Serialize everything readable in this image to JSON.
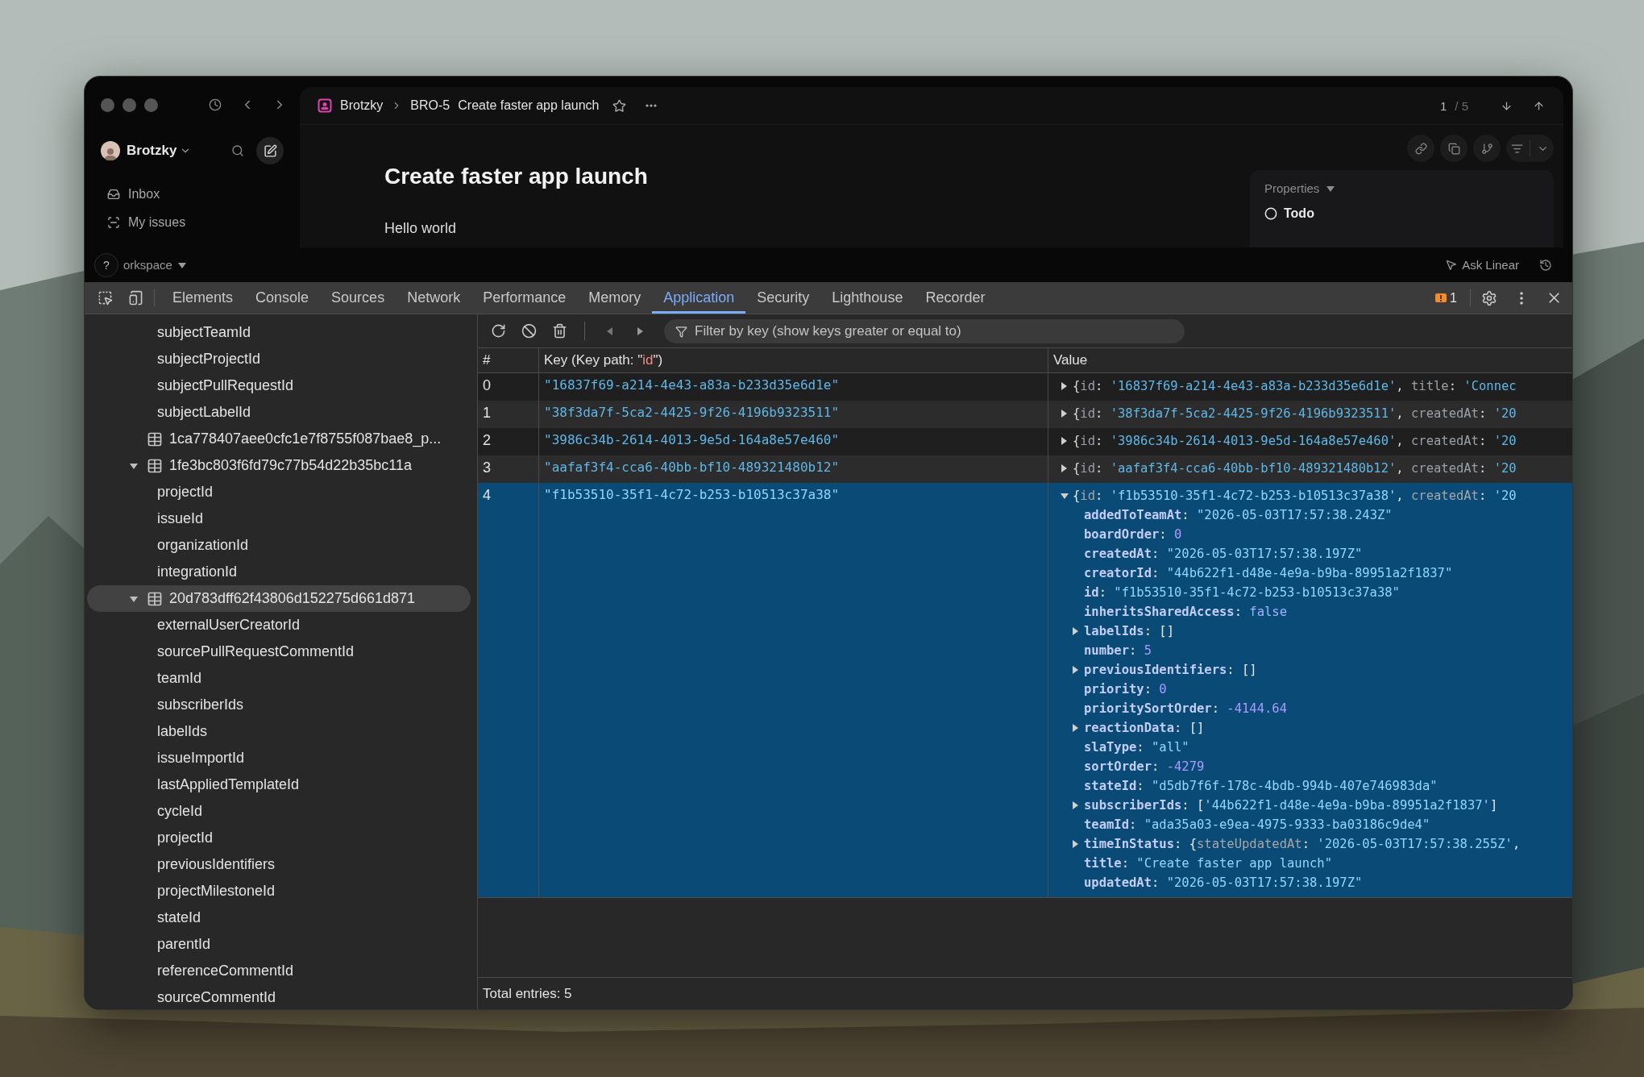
{
  "topbar": {
    "team": "Brotzky",
    "issue_id": "BRO-5",
    "issue_title": "Create faster app launch",
    "pager_current": "1",
    "pager_total": "/ 5"
  },
  "sidebar": {
    "workspace": "Brotzky",
    "items": [
      {
        "label": "Inbox",
        "kind": "inbox"
      },
      {
        "label": "My issues",
        "kind": "issues"
      }
    ],
    "help": "?",
    "workspace_menu": "orkspace"
  },
  "issue": {
    "title": "Create faster app launch",
    "body": "Hello world"
  },
  "properties": {
    "heading": "Properties",
    "status": "Todo"
  },
  "ask": "Ask Linear",
  "devtools": {
    "tabs": [
      {
        "label": "Elements",
        "selected": false
      },
      {
        "label": "Console",
        "selected": false
      },
      {
        "label": "Sources",
        "selected": false
      },
      {
        "label": "Network",
        "selected": false
      },
      {
        "label": "Performance",
        "selected": false
      },
      {
        "label": "Memory",
        "selected": false
      },
      {
        "label": "Application",
        "selected": true
      },
      {
        "label": "Security",
        "selected": false
      },
      {
        "label": "Lighthouse",
        "selected": false
      },
      {
        "label": "Recorder",
        "selected": false
      }
    ],
    "issues_count": "1",
    "tree": [
      {
        "kind": "index",
        "label": "subjectTeamId"
      },
      {
        "kind": "index",
        "label": "subjectProjectId"
      },
      {
        "kind": "index",
        "label": "subjectPullRequestId"
      },
      {
        "kind": "index",
        "label": "subjectLabelId"
      },
      {
        "kind": "store",
        "label": "1ca778407aee0cfc1e7f8755f087bae8_p...",
        "selected": false
      },
      {
        "kind": "store",
        "label": "1fe3bc803f6fd79c77b54d22b35bc11a",
        "selected": false,
        "expanded": true,
        "children": [
          "projectId",
          "issueId",
          "organizationId",
          "integrationId"
        ]
      },
      {
        "kind": "store",
        "label": "20d783dff62f43806d152275d661d871",
        "selected": true,
        "expanded": true,
        "children": [
          "externalUserCreatorId",
          "sourcePullRequestCommentId",
          "teamId",
          "subscriberIds",
          "labelIds",
          "issueImportId",
          "lastAppliedTemplateId",
          "cycleId",
          "projectId",
          "previousIdentifiers",
          "projectMilestoneId",
          "stateId",
          "parentId",
          "referenceCommentId",
          "sourceCommentId"
        ]
      }
    ],
    "filter": {
      "placeholder": "Filter by key (show keys greater or equal to)"
    },
    "columns": {
      "index": "#",
      "key_prefix": "Key (Key path: \"",
      "key_path": "id",
      "key_suffix": "\")",
      "value": "Value"
    },
    "rows": [
      {
        "index": "0",
        "key": "\"16837f69-a214-4e43-a83a-b233d35e6d1e\"",
        "selected": false,
        "expanded": false,
        "summary": [
          {
            "text": "{",
            "kind": "punct"
          },
          {
            "text": "id",
            "kind": "key"
          },
          {
            "text": ": ",
            "kind": "punct"
          },
          {
            "text": "'16837f69-a214-4e43-a83a-b233d35e6d1e'",
            "kind": "string"
          },
          {
            "text": ", ",
            "kind": "punct"
          },
          {
            "text": "title",
            "kind": "key"
          },
          {
            "text": ": ",
            "kind": "punct"
          },
          {
            "text": "'Connec",
            "kind": "string"
          }
        ]
      },
      {
        "index": "1",
        "key": "\"38f3da7f-5ca2-4425-9f26-4196b9323511\"",
        "selected": false,
        "expanded": false,
        "summary": [
          {
            "text": "{",
            "kind": "punct"
          },
          {
            "text": "id",
            "kind": "key"
          },
          {
            "text": ": ",
            "kind": "punct"
          },
          {
            "text": "'38f3da7f-5ca2-4425-9f26-4196b9323511'",
            "kind": "string"
          },
          {
            "text": ", ",
            "kind": "punct"
          },
          {
            "text": "createdAt",
            "kind": "key"
          },
          {
            "text": ": ",
            "kind": "punct"
          },
          {
            "text": "'20",
            "kind": "string"
          }
        ]
      },
      {
        "index": "2",
        "key": "\"3986c34b-2614-4013-9e5d-164a8e57e460\"",
        "selected": false,
        "expanded": false,
        "summary": [
          {
            "text": "{",
            "kind": "punct"
          },
          {
            "text": "id",
            "kind": "key"
          },
          {
            "text": ": ",
            "kind": "punct"
          },
          {
            "text": "'3986c34b-2614-4013-9e5d-164a8e57e460'",
            "kind": "string"
          },
          {
            "text": ", ",
            "kind": "punct"
          },
          {
            "text": "createdAt",
            "kind": "key"
          },
          {
            "text": ": ",
            "kind": "punct"
          },
          {
            "text": "'20",
            "kind": "string"
          }
        ]
      },
      {
        "index": "3",
        "key": "\"aafaf3f4-cca6-40bb-bf10-489321480b12\"",
        "selected": false,
        "expanded": false,
        "summary": [
          {
            "text": "{",
            "kind": "punct"
          },
          {
            "text": "id",
            "kind": "key"
          },
          {
            "text": ": ",
            "kind": "punct"
          },
          {
            "text": "'aafaf3f4-cca6-40bb-bf10-489321480b12'",
            "kind": "string"
          },
          {
            "text": ", ",
            "kind": "punct"
          },
          {
            "text": "createdAt",
            "kind": "key"
          },
          {
            "text": ": ",
            "kind": "punct"
          },
          {
            "text": "'20",
            "kind": "string"
          }
        ]
      },
      {
        "index": "4",
        "key": "\"f1b53510-35f1-4c72-b253-b10513c37a38\"",
        "selected": true,
        "expanded": true,
        "summary": [
          {
            "text": "{",
            "kind": "punct"
          },
          {
            "text": "id",
            "kind": "key"
          },
          {
            "text": ": ",
            "kind": "punct"
          },
          {
            "text": "'f1b53510-35f1-4c72-b253-b10513c37a38'",
            "kind": "string"
          },
          {
            "text": ", ",
            "kind": "punct"
          },
          {
            "text": "createdAt",
            "kind": "key"
          },
          {
            "text": ": ",
            "kind": "punct"
          },
          {
            "text": "'20",
            "kind": "string"
          }
        ],
        "props": [
          {
            "name": "addedToTeamAt",
            "expandable": false,
            "value": [
              {
                "text": ": ",
                "kind": "punct"
              },
              {
                "text": "\"2026-05-03T17:57:38.243Z\"",
                "kind": "string"
              }
            ]
          },
          {
            "name": "boardOrder",
            "expandable": false,
            "value": [
              {
                "text": ": ",
                "kind": "punct"
              },
              {
                "text": "0",
                "kind": "number"
              }
            ]
          },
          {
            "name": "createdAt",
            "expandable": false,
            "value": [
              {
                "text": ": ",
                "kind": "punct"
              },
              {
                "text": "\"2026-05-03T17:57:38.197Z\"",
                "kind": "string"
              }
            ]
          },
          {
            "name": "creatorId",
            "expandable": false,
            "value": [
              {
                "text": ": ",
                "kind": "punct"
              },
              {
                "text": "\"44b622f1-d48e-4e9a-b9ba-89951a2f1837\"",
                "kind": "string"
              }
            ]
          },
          {
            "name": "id",
            "expandable": false,
            "value": [
              {
                "text": ": ",
                "kind": "punct"
              },
              {
                "text": "\"f1b53510-35f1-4c72-b253-b10513c37a38\"",
                "kind": "string"
              }
            ]
          },
          {
            "name": "inheritsSharedAccess",
            "expandable": false,
            "value": [
              {
                "text": ": ",
                "kind": "punct"
              },
              {
                "text": "false",
                "kind": "boolean"
              }
            ]
          },
          {
            "name": "labelIds",
            "expandable": true,
            "value": [
              {
                "text": ": ",
                "kind": "punct"
              },
              {
                "text": "[]",
                "kind": "punct"
              }
            ]
          },
          {
            "name": "number",
            "expandable": false,
            "value": [
              {
                "text": ": ",
                "kind": "punct"
              },
              {
                "text": "5",
                "kind": "number"
              }
            ]
          },
          {
            "name": "previousIdentifiers",
            "expandable": true,
            "value": [
              {
                "text": ": ",
                "kind": "punct"
              },
              {
                "text": "[]",
                "kind": "punct"
              }
            ]
          },
          {
            "name": "priority",
            "expandable": false,
            "value": [
              {
                "text": ": ",
                "kind": "punct"
              },
              {
                "text": "0",
                "kind": "number"
              }
            ]
          },
          {
            "name": "prioritySortOrder",
            "expandable": false,
            "value": [
              {
                "text": ": ",
                "kind": "punct"
              },
              {
                "text": "-4144.64",
                "kind": "number"
              }
            ]
          },
          {
            "name": "reactionData",
            "expandable": true,
            "value": [
              {
                "text": ": ",
                "kind": "punct"
              },
              {
                "text": "[]",
                "kind": "punct"
              }
            ]
          },
          {
            "name": "slaType",
            "expandable": false,
            "value": [
              {
                "text": ": ",
                "kind": "punct"
              },
              {
                "text": "\"all\"",
                "kind": "string"
              }
            ]
          },
          {
            "name": "sortOrder",
            "expandable": false,
            "value": [
              {
                "text": ": ",
                "kind": "punct"
              },
              {
                "text": "-4279",
                "kind": "number"
              }
            ]
          },
          {
            "name": "stateId",
            "expandable": false,
            "value": [
              {
                "text": ": ",
                "kind": "punct"
              },
              {
                "text": "\"d5db7f6f-178c-4bdb-994b-407e746983da\"",
                "kind": "string"
              }
            ]
          },
          {
            "name": "subscriberIds",
            "expandable": true,
            "value": [
              {
                "text": ": [",
                "kind": "punct"
              },
              {
                "text": "'44b622f1-d48e-4e9a-b9ba-89951a2f1837'",
                "kind": "string"
              },
              {
                "text": "]",
                "kind": "punct"
              }
            ]
          },
          {
            "name": "teamId",
            "expandable": false,
            "value": [
              {
                "text": ": ",
                "kind": "punct"
              },
              {
                "text": "\"ada35a03-e9ea-4975-9333-ba03186c9de4\"",
                "kind": "string"
              }
            ]
          },
          {
            "name": "timeInStatus",
            "expandable": true,
            "value": [
              {
                "text": ": {",
                "kind": "punct"
              },
              {
                "text": "stateUpdatedAt",
                "kind": "key"
              },
              {
                "text": ": ",
                "kind": "punct"
              },
              {
                "text": "'2026-05-03T17:57:38.255Z'",
                "kind": "string"
              },
              {
                "text": ",",
                "kind": "punct"
              }
            ]
          },
          {
            "name": "title",
            "expandable": false,
            "value": [
              {
                "text": ": ",
                "kind": "punct"
              },
              {
                "text": "\"Create faster app launch\"",
                "kind": "string"
              }
            ]
          },
          {
            "name": "updatedAt",
            "expandable": false,
            "value": [
              {
                "text": ": ",
                "kind": "punct"
              },
              {
                "text": "\"2026-05-03T17:57:38.197Z\"",
                "kind": "string"
              }
            ]
          }
        ]
      }
    ],
    "total": "Total entries: 5"
  }
}
